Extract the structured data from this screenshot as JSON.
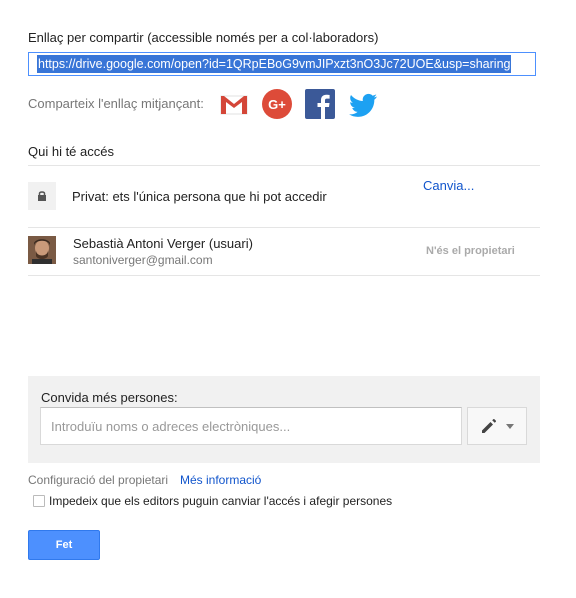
{
  "link": {
    "label": "Enllaç per compartir (accessible només per a col·laboradors)",
    "url": "https://drive.google.com/open?id=1QRpEBoG9vmJIPxzt3nO3Jc72UOE&usp=sharing"
  },
  "share": {
    "label": "Comparteix l'enllaç mitjançant:",
    "icons": [
      "gmail-icon",
      "google-plus-icon",
      "facebook-icon",
      "twitter-icon"
    ]
  },
  "access": {
    "title": "Qui hi té accés",
    "private_text": "Privat: ets l'única persona que hi pot accedir",
    "change_link": "Canvia..."
  },
  "user": {
    "name": "Sebastià Antoni Verger (usuari)",
    "email": "santoniverger@gmail.com",
    "role": "N'és el propietari"
  },
  "invite": {
    "label": "Convida més persones:",
    "placeholder": "Introduïu noms o adreces electròniques..."
  },
  "owner": {
    "settings_label": "Configuració del propietari",
    "more_info": "Més informació",
    "checkbox_label": "Impedeix que els editors puguin canviar l'accés i afegir persones"
  },
  "done_button": "Fet",
  "colors": {
    "accent": "#4d90fe",
    "link": "#1155cc",
    "gmail_red": "#d44638",
    "gplus_red": "#dd4b39",
    "facebook_blue": "#3b5998",
    "twitter_blue": "#1da1f2"
  }
}
